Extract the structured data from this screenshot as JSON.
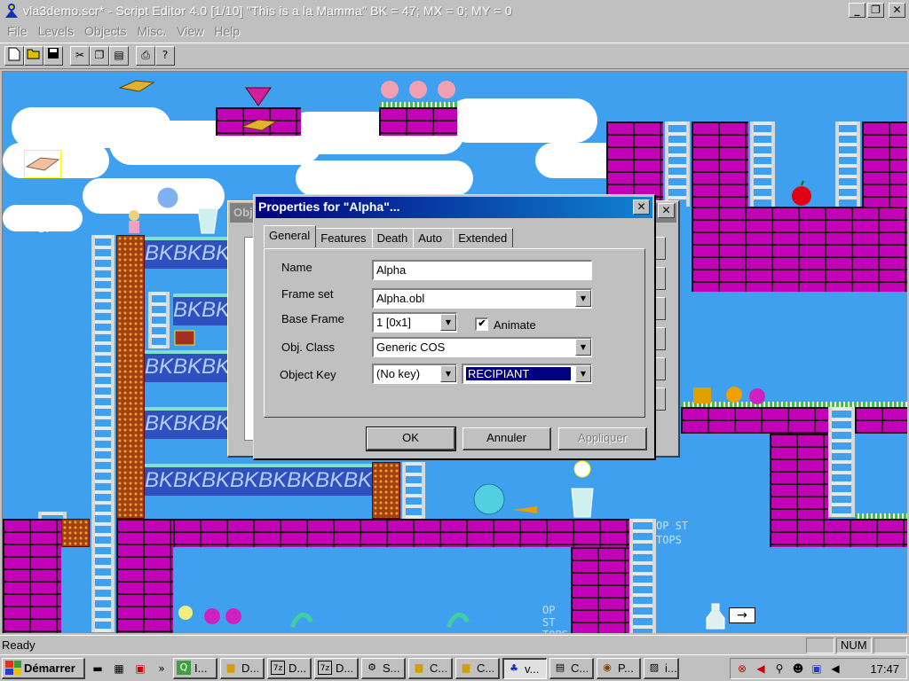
{
  "window": {
    "title": "vla3demo.scr* - Script Editor 4.0 [1/10] \"This is a la Mamma\" BK = 47; MX = 0; MY = 0",
    "minimize": "_",
    "restore": "❐",
    "close": "✕"
  },
  "menu": {
    "file": "File",
    "levels": "Levels",
    "objects": "Objects",
    "misc": "Misc.",
    "view": "View",
    "help": "Help"
  },
  "toolbar": {
    "new": "new-icon",
    "open": "open-icon",
    "save": "save-icon",
    "cut": "cut-icon",
    "copy": "copy-icon",
    "paste": "paste-icon",
    "print": "print-icon",
    "help": "help-icon"
  },
  "back_dialog": {
    "title": "Obj",
    "close": "✕"
  },
  "dialog": {
    "title": "Properties for \"Alpha\"...",
    "close": "✕",
    "tabs": [
      "General",
      "Features",
      "Death",
      "Auto",
      "Extended"
    ],
    "fields": {
      "name_label": "Name",
      "name_value": "Alpha",
      "frameset_label": "Frame set",
      "frameset_value": "Alpha.obl",
      "baseframe_label": "Base Frame",
      "baseframe_value": "1 [0x1]",
      "animate_label": "Animate",
      "animate_checked": "✔",
      "objclass_label": "Obj. Class",
      "objclass_value": "Generic COS",
      "objkey_label": "Object Key",
      "objkey_value": "(No key)",
      "objkey2_value": "RECIPIANT"
    },
    "buttons": {
      "ok": "OK",
      "cancel": "Annuler",
      "apply": "Appliquer"
    }
  },
  "game": {
    "bk_text": "BKBKBKBKBKBKBKBKBKBKBK",
    "bk_short": "BKBKBK",
    "sign_arrow": "→",
    "stop_text": "OP ST TOPS",
    "side_tag": "SI"
  },
  "status": {
    "text": "Ready",
    "num": "NUM"
  },
  "taskbar": {
    "start": "Démarrer",
    "more": "»",
    "tasks": [
      {
        "icon": "Q",
        "label": "I..."
      },
      {
        "icon": "▆",
        "label": "D..."
      },
      {
        "icon": "7z",
        "label": "D..."
      },
      {
        "icon": "7z",
        "label": "D..."
      },
      {
        "icon": "⚙",
        "label": "S..."
      },
      {
        "icon": "▆",
        "label": "C..."
      },
      {
        "icon": "▆",
        "label": "C..."
      },
      {
        "icon": "♣",
        "label": "v..."
      },
      {
        "icon": "▤",
        "label": "C..."
      },
      {
        "icon": "◉",
        "label": "P..."
      },
      {
        "icon": "▨",
        "label": "i..."
      }
    ],
    "clock": "17:47"
  },
  "colors": {
    "sky": "#3fa0ef",
    "brick": "#c400b8",
    "title_active": "#000080"
  }
}
